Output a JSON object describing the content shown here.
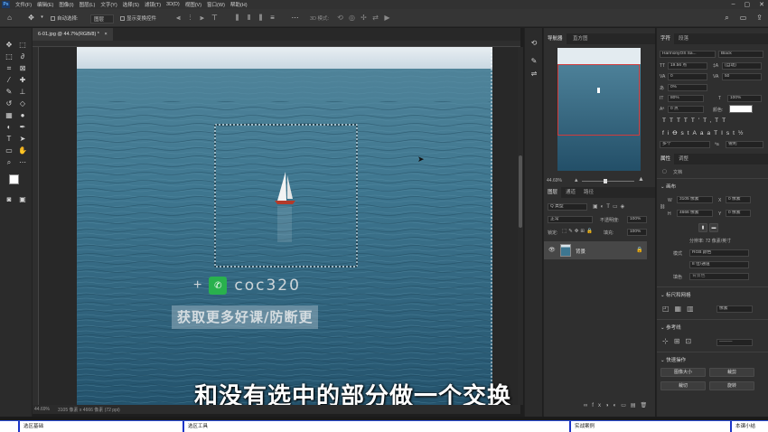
{
  "menu": {
    "items": [
      "文件(F)",
      "编辑(E)",
      "图像(I)",
      "图层(L)",
      "文字(Y)",
      "选择(S)",
      "滤镜(T)",
      "3D(D)",
      "视图(V)",
      "窗口(W)",
      "帮助(H)"
    ]
  },
  "options": {
    "auto_select": "自动选择:",
    "layer_mode": "图层",
    "show_transform": "显示变换控件",
    "mode_3d": "3D 模式:"
  },
  "document": {
    "tab_title": "6-01.jpg @ 44.7%(RGB/8) *",
    "zoom": "44.69%",
    "size_info": "3105 像素 x 4666 像素 (72 ppi)"
  },
  "overlay": {
    "watermark_plus": "+",
    "watermark_id": "coc320",
    "watermark_sub": "获取更多好课/防断更",
    "subtitle": "和没有选中的部分做一个交换"
  },
  "navigator": {
    "tab_nav": "导航器",
    "tab_hist": "直方图",
    "zoom": "44.69%"
  },
  "layers": {
    "tab_layers": "图层",
    "tab_channels": "通道",
    "tab_paths": "路径",
    "filter_kind": "Q 类型",
    "blend_mode": "正常",
    "opacity_label": "不透明度:",
    "opacity_value": "100%",
    "lock_label": "锁定:",
    "fill_label": "填充:",
    "fill_value": "100%",
    "layer_name": "背景"
  },
  "character": {
    "tab_char": "字符",
    "tab_para": "段落",
    "font_family": "HarmonyOS Sa...",
    "font_style": "Black",
    "font_size": "19.56 点",
    "leading": "(自动)",
    "kerning": "0",
    "tracking": "50",
    "baseline_pct": "0%",
    "vscale": "80%",
    "hscale": "100%",
    "baseline_shift": "0 点",
    "color_label": "颜色:",
    "language": "多个",
    "aa": "锐利"
  },
  "properties": {
    "tab_props": "属性",
    "tab_adjust": "调整",
    "doc_label": "文档",
    "canvas_title": "画布",
    "w_label": "W",
    "w_value": "3105 像素",
    "x_label": "X",
    "x_value": "0 像素",
    "h_label": "H",
    "h_value": "4666 像素",
    "y_label": "Y",
    "y_value": "0 像素",
    "resolution": "分辨率: 72 像素/英寸",
    "mode_label": "模式",
    "mode_value": "RGB 颜色",
    "depth_value": "8 位/通道",
    "fill_label": "填色",
    "fill_value": "背景色",
    "rulers_title": "标尺和网格",
    "units": "像素",
    "guides_title": "参考线",
    "quick_title": "快速操作",
    "btn_image_size": "图像大小",
    "btn_crop": "裁剪",
    "btn_trim": "裁切",
    "btn_rotate": "旋转"
  },
  "timeline": {
    "segments": [
      "选区基础",
      "选区工具",
      "实战案例",
      "本课小结"
    ]
  }
}
